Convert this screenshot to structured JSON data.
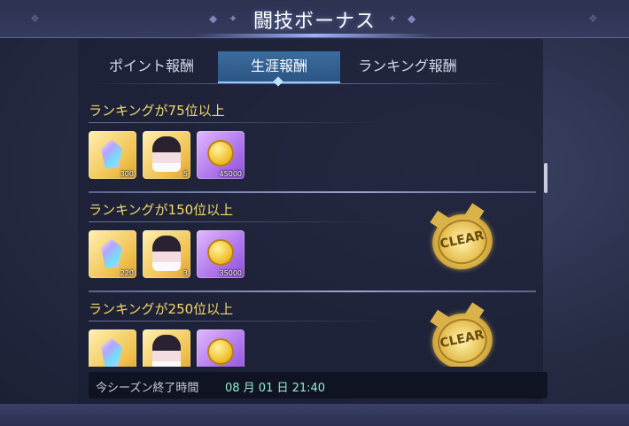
{
  "title": "闘技ボーナス",
  "tabs": [
    {
      "label": "ポイント報酬",
      "active": false
    },
    {
      "label": "生涯報酬",
      "active": true
    },
    {
      "label": "ランキング報酬",
      "active": false
    }
  ],
  "rewards": [
    {
      "title": "ランキングが75位以上",
      "cleared": false,
      "items": [
        {
          "icon": "crystal-icon",
          "frame": "gold",
          "qty": "300"
        },
        {
          "icon": "character-ticket-icon",
          "frame": "gold",
          "qty": "5"
        },
        {
          "icon": "gold-coin-icon",
          "frame": "purple",
          "qty": "45000"
        }
      ]
    },
    {
      "title": "ランキングが150位以上",
      "cleared": true,
      "stamp": "CLEAR",
      "items": [
        {
          "icon": "crystal-icon",
          "frame": "gold",
          "qty": "220"
        },
        {
          "icon": "character-ticket-icon",
          "frame": "gold",
          "qty": "3"
        },
        {
          "icon": "gold-coin-icon",
          "frame": "purple",
          "qty": "35000"
        }
      ]
    },
    {
      "title": "ランキングが250位以上",
      "cleared": true,
      "stamp": "CLEAR",
      "items": [
        {
          "icon": "crystal-icon",
          "frame": "gold",
          "qty": ""
        },
        {
          "icon": "character-ticket-icon",
          "frame": "gold",
          "qty": ""
        },
        {
          "icon": "gold-coin-icon",
          "frame": "purple",
          "qty": ""
        }
      ]
    }
  ],
  "footer": {
    "label": "今シーズン終了時間",
    "time": "08 月 01 日 21:40"
  },
  "colors": {
    "row_title": "#f3d86a",
    "time_text": "#8df0d0",
    "active_tab": "#3a6c9f"
  }
}
